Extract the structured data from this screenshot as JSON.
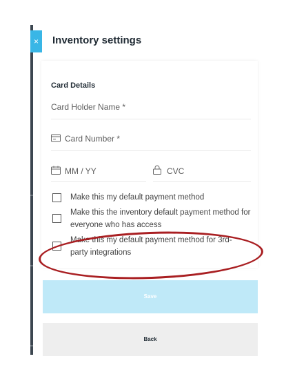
{
  "header": {
    "title": "Inventory settings",
    "close_glyph": "×"
  },
  "card": {
    "section_title": "Card Details",
    "holder_placeholder": "Card Holder Name *",
    "number_placeholder": "Card Number *",
    "expiry_placeholder": "MM / YY",
    "cvc_placeholder": "CVC"
  },
  "checkboxes": [
    {
      "label": "Make this my default payment method",
      "checked": false
    },
    {
      "label": "Make this the inventory default payment method for everyone who has access",
      "checked": false
    },
    {
      "label": "Make this my default payment method for 3rd-party integrations",
      "checked": false
    }
  ],
  "buttons": {
    "save": "Save",
    "back": "Back"
  },
  "colors": {
    "accent": "#39b6e6",
    "save_bg": "#bfe9f8",
    "annotation": "#a91f22"
  }
}
